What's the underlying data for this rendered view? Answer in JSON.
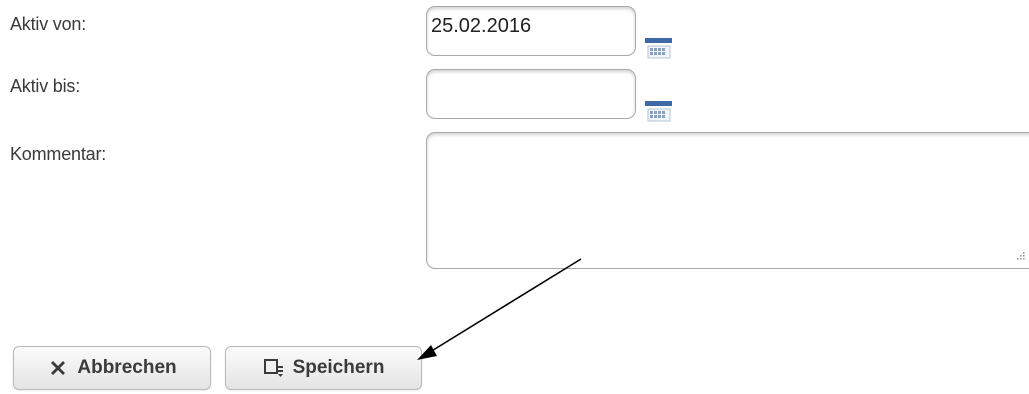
{
  "form": {
    "active_from": {
      "label": "Aktiv von:",
      "value": "25.02.2016",
      "calendar_icon": "calendar-icon"
    },
    "active_to": {
      "label": "Aktiv bis:",
      "value": "",
      "calendar_icon": "calendar-icon"
    },
    "comment": {
      "label": "Kommentar:",
      "value": ""
    }
  },
  "buttons": {
    "cancel": {
      "label": "Abbrechen",
      "icon": "close-icon"
    },
    "save": {
      "label": "Speichern",
      "icon": "save-icon"
    }
  },
  "annotation": {
    "type": "arrow",
    "color": "#000000",
    "points_to": "save-button"
  }
}
